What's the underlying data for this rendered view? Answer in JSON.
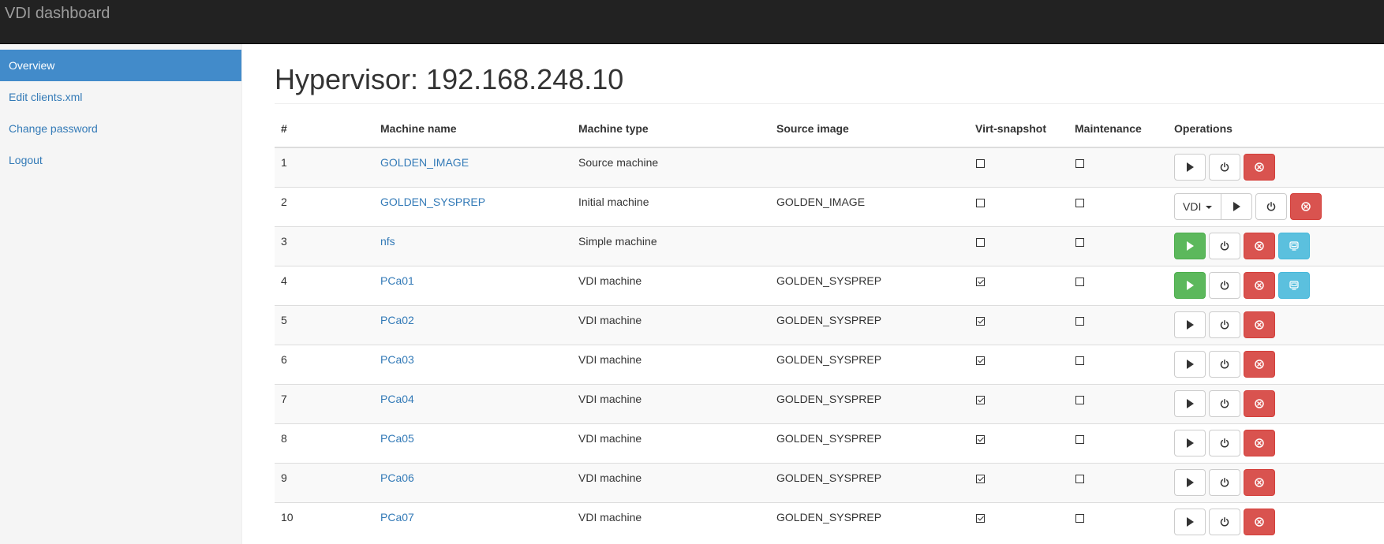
{
  "app": {
    "title": "VDI dashboard"
  },
  "sidebar": {
    "items": [
      {
        "label": "Overview",
        "active": true
      },
      {
        "label": "Edit clients.xml"
      },
      {
        "label": "Change password"
      },
      {
        "label": "Logout"
      }
    ]
  },
  "page": {
    "title": "Hypervisor: 192.168.248.10"
  },
  "table": {
    "headers": [
      "#",
      "Machine name",
      "Machine type",
      "Source image",
      "Virt-snapshot",
      "Maintenance",
      "Operations"
    ],
    "rows": [
      {
        "num": "1",
        "name": "GOLDEN_IMAGE",
        "type": "Source machine",
        "source": "",
        "snapshot": false,
        "maintenance": false
      },
      {
        "num": "2",
        "name": "GOLDEN_SYSPREP",
        "type": "Initial machine",
        "source": "GOLDEN_IMAGE",
        "snapshot": false,
        "maintenance": false,
        "dropdown": "VDI"
      },
      {
        "num": "3",
        "name": "nfs",
        "type": "Simple machine",
        "source": "",
        "snapshot": false,
        "maintenance": false
      },
      {
        "num": "4",
        "name": "PCa01",
        "type": "VDI machine",
        "source": "GOLDEN_SYSPREP",
        "snapshot": true,
        "maintenance": false
      },
      {
        "num": "5",
        "name": "PCa02",
        "type": "VDI machine",
        "source": "GOLDEN_SYSPREP",
        "snapshot": true,
        "maintenance": false
      },
      {
        "num": "6",
        "name": "PCa03",
        "type": "VDI machine",
        "source": "GOLDEN_SYSPREP",
        "snapshot": true,
        "maintenance": false
      },
      {
        "num": "7",
        "name": "PCa04",
        "type": "VDI machine",
        "source": "GOLDEN_SYSPREP",
        "snapshot": true,
        "maintenance": false
      },
      {
        "num": "8",
        "name": "PCa05",
        "type": "VDI machine",
        "source": "GOLDEN_SYSPREP",
        "snapshot": true,
        "maintenance": false
      },
      {
        "num": "9",
        "name": "PCa06",
        "type": "VDI machine",
        "source": "GOLDEN_SYSPREP",
        "snapshot": true,
        "maintenance": false
      },
      {
        "num": "10",
        "name": "PCa07",
        "type": "VDI machine",
        "source": "GOLDEN_SYSPREP",
        "snapshot": true,
        "maintenance": false
      }
    ]
  },
  "colors": {
    "navbar": "#222222",
    "active": "#428bca",
    "link": "#337ab7",
    "success": "#5cb85c",
    "danger": "#d9534f",
    "info": "#5bc0de"
  },
  "icons": {
    "play": "play-icon",
    "power": "power-icon",
    "destroy": "remove-circle-icon",
    "console": "monitor-icon"
  }
}
